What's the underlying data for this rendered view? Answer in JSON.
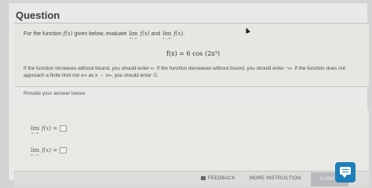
{
  "header": {
    "title": "Question"
  },
  "problem": {
    "prefix": "For the function",
    "fx": "f(x)",
    "middle": "given below, evaluate",
    "lim_word": "lim",
    "lim1_sub": "x→∞",
    "lim1_expr": "f(x)",
    "and": "and",
    "lim2_sub": "x→-∞",
    "lim2_expr": "f(x).",
    "formula": "f(x) = 6 cos (2x³)",
    "instructions": "If the function increases without bound, you should enter ∞. If the function decreases without bound, you should enter −∞. If the function does not approach a finite limit not ±∞ as x → ±∞, you should enter ∅."
  },
  "answer": {
    "prompt": "Provide your answer below:",
    "row1_lim": "lim",
    "row1_sub": "x→∞",
    "row1_expr": "f(x) =",
    "row2_lim": "lim",
    "row2_sub": "x→-∞",
    "row2_expr": "f(x) ="
  },
  "footer": {
    "feedback": "FEEDBACK",
    "more_instruction": "MORE INSTRUCTION",
    "submit": "SUBMIT"
  }
}
